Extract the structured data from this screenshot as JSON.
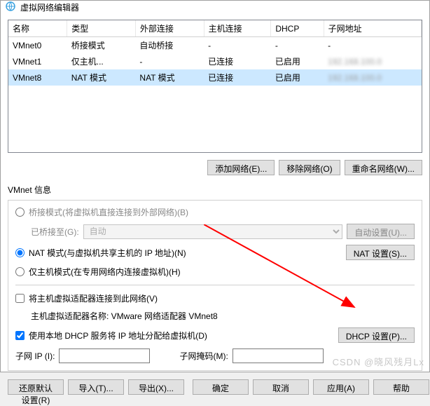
{
  "title": "虚拟网络编辑器",
  "table": {
    "headers": [
      "名称",
      "类型",
      "外部连接",
      "主机连接",
      "DHCP",
      "子网地址"
    ],
    "rows": [
      {
        "name": "VMnet0",
        "type": "桥接模式",
        "ext": "自动桥接",
        "host": "-",
        "dhcp": "-",
        "subnet": "-",
        "sel": false
      },
      {
        "name": "VMnet1",
        "type": "仅主机...",
        "ext": "-",
        "host": "已连接",
        "dhcp": "已启用",
        "subnet": "",
        "sel": false,
        "blur": true
      },
      {
        "name": "VMnet8",
        "type": "NAT 模式",
        "ext": "NAT 模式",
        "host": "已连接",
        "dhcp": "已启用",
        "subnet": "",
        "sel": true,
        "blur": true
      }
    ]
  },
  "buttons": {
    "add_net": "添加网络(E)...",
    "remove_net": "移除网络(O)",
    "rename_net": "重命名网络(W)...",
    "auto_settings": "自动设置(U)...",
    "nat_settings": "NAT 设置(S)...",
    "dhcp_settings": "DHCP 设置(P)...",
    "restore": "还原默认设置(R)",
    "import": "导入(T)...",
    "export": "导出(X)...",
    "ok": "确定",
    "cancel": "取消",
    "apply": "应用(A)",
    "help": "帮助"
  },
  "labels": {
    "vmnet_info": "VMnet 信息",
    "bridged": "桥接模式(将虚拟机直接连接到外部网络)(B)",
    "bridged_to": "已桥接至(G):",
    "bridged_value": "自动",
    "nat": "NAT 模式(与虚拟机共享主机的 IP 地址)(N)",
    "hostonly": "仅主机模式(在专用网络内连接虚拟机)(H)",
    "connect_host": "将主机虚拟适配器连接到此网络(V)",
    "adapter_name": "主机虚拟适配器名称: VMware 网络适配器 VMnet8",
    "use_dhcp": "使用本地 DHCP 服务将 IP 地址分配给虚拟机(D)",
    "subnet_ip": "子网 IP (I):",
    "subnet_mask": "子网掩码(M):"
  },
  "watermark": "CSDN @晓风残月Lx"
}
